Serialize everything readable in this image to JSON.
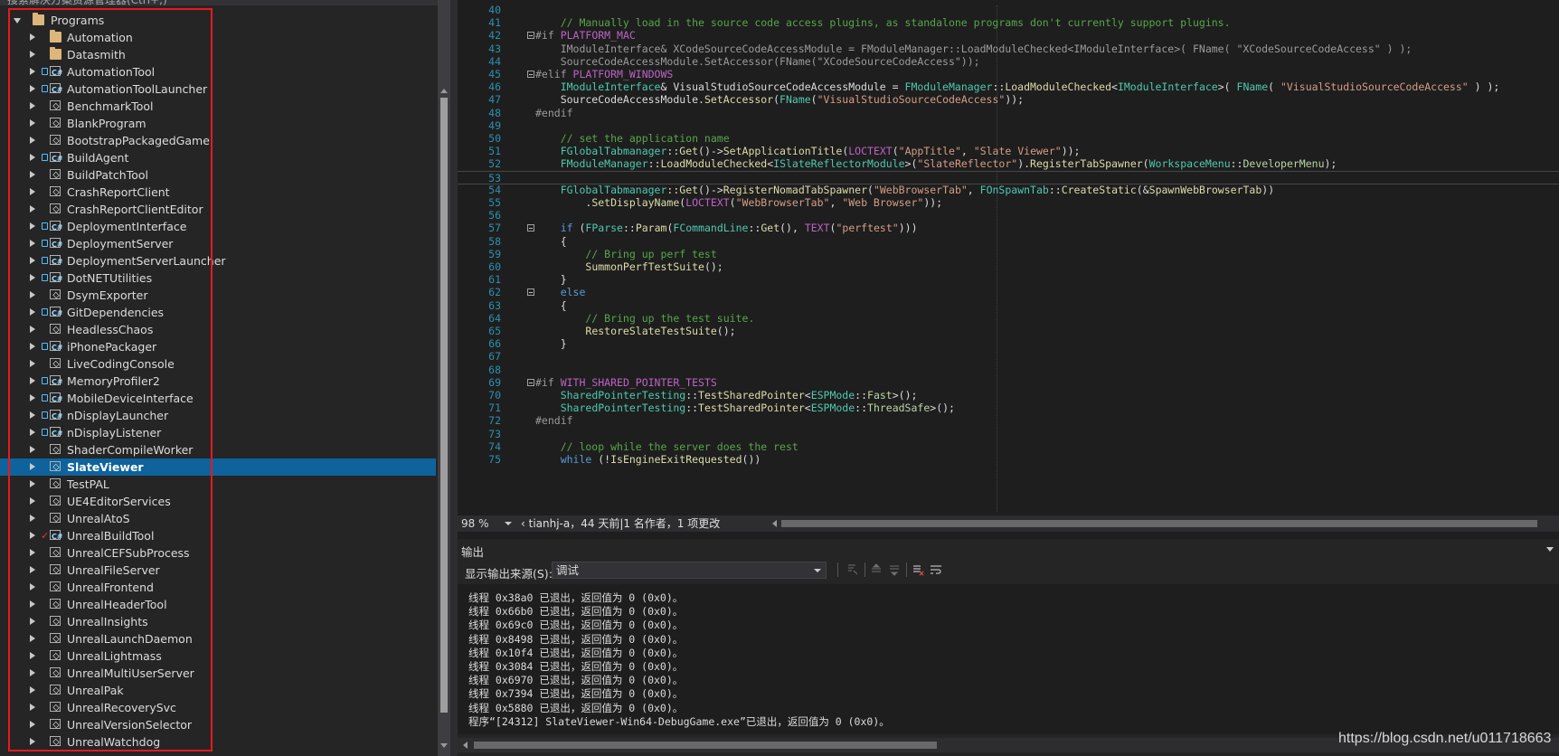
{
  "explorer": {
    "toolbar_text": "搜索解决方案资源管理器(Ctrl+;)",
    "root": {
      "label": "Programs",
      "icon": "folder-icon"
    },
    "items": [
      {
        "label": "Automation",
        "icon": "folder",
        "lock": false,
        "check": false
      },
      {
        "label": "Datasmith",
        "icon": "folder",
        "lock": false,
        "check": false
      },
      {
        "label": "AutomationTool",
        "icon": "cs",
        "lock": true,
        "check": false
      },
      {
        "label": "AutomationToolLauncher",
        "icon": "cs",
        "lock": true,
        "check": false
      },
      {
        "label": "BenchmarkTool",
        "icon": "cpp",
        "lock": false,
        "check": false
      },
      {
        "label": "BlankProgram",
        "icon": "cpp",
        "lock": false,
        "check": false
      },
      {
        "label": "BootstrapPackagedGame",
        "icon": "cpp",
        "lock": false,
        "check": false
      },
      {
        "label": "BuildAgent",
        "icon": "cs",
        "lock": true,
        "check": false
      },
      {
        "label": "BuildPatchTool",
        "icon": "cpp",
        "lock": false,
        "check": false
      },
      {
        "label": "CrashReportClient",
        "icon": "cpp",
        "lock": false,
        "check": false
      },
      {
        "label": "CrashReportClientEditor",
        "icon": "cpp",
        "lock": false,
        "check": false
      },
      {
        "label": "DeploymentInterface",
        "icon": "cs",
        "lock": true,
        "check": false
      },
      {
        "label": "DeploymentServer",
        "icon": "cs",
        "lock": true,
        "check": false
      },
      {
        "label": "DeploymentServerLauncher",
        "icon": "cs",
        "lock": true,
        "check": false
      },
      {
        "label": "DotNETUtilities",
        "icon": "cs",
        "lock": true,
        "check": false
      },
      {
        "label": "DsymExporter",
        "icon": "cpp",
        "lock": false,
        "check": false
      },
      {
        "label": "GitDependencies",
        "icon": "cs",
        "lock": true,
        "check": false
      },
      {
        "label": "HeadlessChaos",
        "icon": "cpp",
        "lock": false,
        "check": false
      },
      {
        "label": "iPhonePackager",
        "icon": "cs",
        "lock": true,
        "check": false
      },
      {
        "label": "LiveCodingConsole",
        "icon": "cpp",
        "lock": false,
        "check": false
      },
      {
        "label": "MemoryProfiler2",
        "icon": "cs",
        "lock": true,
        "check": false
      },
      {
        "label": "MobileDeviceInterface",
        "icon": "cs",
        "lock": true,
        "check": false
      },
      {
        "label": "nDisplayLauncher",
        "icon": "cs",
        "lock": true,
        "check": false
      },
      {
        "label": "nDisplayListener",
        "icon": "cs",
        "lock": true,
        "check": false
      },
      {
        "label": "ShaderCompileWorker",
        "icon": "cpp",
        "lock": false,
        "check": false
      },
      {
        "label": "SlateViewer",
        "icon": "cpp",
        "lock": false,
        "check": false,
        "selected": true
      },
      {
        "label": "TestPAL",
        "icon": "cpp",
        "lock": false,
        "check": false
      },
      {
        "label": "UE4EditorServices",
        "icon": "cpp",
        "lock": false,
        "check": false
      },
      {
        "label": "UnrealAtoS",
        "icon": "cpp",
        "lock": false,
        "check": false
      },
      {
        "label": "UnrealBuildTool",
        "icon": "cs",
        "lock": false,
        "check": true
      },
      {
        "label": "UnrealCEFSubProcess",
        "icon": "cpp",
        "lock": false,
        "check": false
      },
      {
        "label": "UnrealFileServer",
        "icon": "cpp",
        "lock": false,
        "check": false
      },
      {
        "label": "UnrealFrontend",
        "icon": "cpp",
        "lock": false,
        "check": false
      },
      {
        "label": "UnrealHeaderTool",
        "icon": "cpp",
        "lock": false,
        "check": false
      },
      {
        "label": "UnrealInsights",
        "icon": "cpp",
        "lock": false,
        "check": false
      },
      {
        "label": "UnrealLaunchDaemon",
        "icon": "cpp",
        "lock": false,
        "check": false
      },
      {
        "label": "UnrealLightmass",
        "icon": "cpp",
        "lock": false,
        "check": false
      },
      {
        "label": "UnrealMultiUserServer",
        "icon": "cpp",
        "lock": false,
        "check": false
      },
      {
        "label": "UnrealPak",
        "icon": "cpp",
        "lock": false,
        "check": false
      },
      {
        "label": "UnrealRecoverySvc",
        "icon": "cpp",
        "lock": false,
        "check": false
      },
      {
        "label": "UnrealVersionSelector",
        "icon": "cpp",
        "lock": false,
        "check": false
      },
      {
        "label": "UnrealWatchdog",
        "icon": "cpp",
        "lock": false,
        "check": false
      }
    ],
    "annotation_color": "#e8191b",
    "selection_color": "#0e639c"
  },
  "editor": {
    "lines": [
      {
        "n": "40",
        "fold": false,
        "tokens": [
          [
            "",
            "plain"
          ]
        ]
      },
      {
        "n": "41",
        "fold": false,
        "tokens": [
          [
            "    // Manually load in the source code access plugins, as standalone programs don't currently support plugins.",
            "comment"
          ]
        ]
      },
      {
        "n": "42",
        "fold": true,
        "tokens": [
          [
            "#if ",
            "pp"
          ],
          [
            "PLATFORM_MAC",
            "macro"
          ]
        ]
      },
      {
        "n": "43",
        "fold": false,
        "tokens": [
          [
            "    IModuleInterface& XCodeSourceCodeAccessModule = FModuleManager::LoadModuleChecked<IModuleInterface>( FName( \"XCodeSourceCodeAccess\" ) );",
            "pp"
          ]
        ]
      },
      {
        "n": "44",
        "fold": false,
        "tokens": [
          [
            "    SourceCodeAccessModule.SetAccessor(FName(\"XCodeSourceCodeAccess\"));",
            "pp"
          ]
        ]
      },
      {
        "n": "45",
        "fold": true,
        "tokens": [
          [
            "#elif ",
            "pp"
          ],
          [
            "PLATFORM_WINDOWS",
            "macro"
          ]
        ]
      },
      {
        "n": "46",
        "fold": false,
        "tokens": [
          [
            "    ",
            "plain"
          ],
          [
            "IModuleInterface",
            "type"
          ],
          [
            "& VisualStudioSourceCodeAccessModule = ",
            "plain"
          ],
          [
            "FModuleManager",
            "type"
          ],
          [
            "::",
            "plain"
          ],
          [
            "LoadModuleChecked",
            "fn"
          ],
          [
            "<",
            "plain"
          ],
          [
            "IModuleInterface",
            "type"
          ],
          [
            ">( ",
            "plain"
          ],
          [
            "FName",
            "type"
          ],
          [
            "( ",
            "plain"
          ],
          [
            "\"VisualStudioSourceCodeAccess\"",
            "str"
          ],
          [
            " ) );",
            "plain"
          ]
        ]
      },
      {
        "n": "47",
        "fold": false,
        "tokens": [
          [
            "    SourceCodeAccessModule.",
            "plain"
          ],
          [
            "SetAccessor",
            "fn"
          ],
          [
            "(",
            "plain"
          ],
          [
            "FName",
            "type"
          ],
          [
            "(",
            "plain"
          ],
          [
            "\"VisualStudioSourceCodeAccess\"",
            "str"
          ],
          [
            "));",
            "plain"
          ]
        ]
      },
      {
        "n": "48",
        "fold": false,
        "tokens": [
          [
            "#endif",
            "pp"
          ]
        ]
      },
      {
        "n": "49",
        "fold": false,
        "tokens": [
          [
            "",
            "plain"
          ]
        ]
      },
      {
        "n": "50",
        "fold": false,
        "tokens": [
          [
            "    // set the application name",
            "comment"
          ]
        ]
      },
      {
        "n": "51",
        "fold": false,
        "tokens": [
          [
            "    ",
            "plain"
          ],
          [
            "FGlobalTabmanager",
            "type"
          ],
          [
            "::",
            "plain"
          ],
          [
            "Get",
            "fn"
          ],
          [
            "()->",
            "plain"
          ],
          [
            "SetApplicationTitle",
            "fn"
          ],
          [
            "(",
            "plain"
          ],
          [
            "LOCTEXT",
            "macro"
          ],
          [
            "(",
            "plain"
          ],
          [
            "\"AppTitle\"",
            "str"
          ],
          [
            ", ",
            "plain"
          ],
          [
            "\"Slate Viewer\"",
            "str"
          ],
          [
            "));",
            "plain"
          ]
        ]
      },
      {
        "n": "52",
        "fold": false,
        "tokens": [
          [
            "    ",
            "plain"
          ],
          [
            "FModuleManager",
            "type"
          ],
          [
            "::",
            "plain"
          ],
          [
            "LoadModuleChecked",
            "fn"
          ],
          [
            "<",
            "plain"
          ],
          [
            "ISlateReflectorModule",
            "type"
          ],
          [
            ">(",
            "plain"
          ],
          [
            "\"SlateReflector\"",
            "str"
          ],
          [
            ").",
            "plain"
          ],
          [
            "RegisterTabSpawner",
            "fn"
          ],
          [
            "(",
            "plain"
          ],
          [
            "WorkspaceMenu",
            "type"
          ],
          [
            "::",
            "plain"
          ],
          [
            "DeveloperMenu",
            "purple"
          ],
          [
            ");",
            "plain"
          ]
        ]
      },
      {
        "n": "53",
        "fold": false,
        "current": true,
        "tokens": [
          [
            "",
            "plain"
          ]
        ]
      },
      {
        "n": "54",
        "fold": false,
        "tokens": [
          [
            "    ",
            "plain"
          ],
          [
            "FGlobalTabmanager",
            "type"
          ],
          [
            "::",
            "plain"
          ],
          [
            "Get",
            "fn"
          ],
          [
            "()->",
            "plain"
          ],
          [
            "RegisterNomadTabSpawner",
            "fn"
          ],
          [
            "(",
            "plain"
          ],
          [
            "\"WebBrowserTab\"",
            "str"
          ],
          [
            ", ",
            "plain"
          ],
          [
            "FOnSpawnTab",
            "type"
          ],
          [
            "::",
            "plain"
          ],
          [
            "CreateStatic",
            "fn"
          ],
          [
            "(&",
            "plain"
          ],
          [
            "SpawnWebBrowserTab",
            "fn"
          ],
          [
            "))",
            "plain"
          ]
        ]
      },
      {
        "n": "55",
        "fold": false,
        "tokens": [
          [
            "        .",
            "plain"
          ],
          [
            "SetDisplayName",
            "fn"
          ],
          [
            "(",
            "plain"
          ],
          [
            "LOCTEXT",
            "macro"
          ],
          [
            "(",
            "plain"
          ],
          [
            "\"WebBrowserTab\"",
            "str"
          ],
          [
            ", ",
            "plain"
          ],
          [
            "\"Web Browser\"",
            "str"
          ],
          [
            "));",
            "plain"
          ]
        ]
      },
      {
        "n": "56",
        "fold": false,
        "tokens": [
          [
            "",
            "plain"
          ]
        ]
      },
      {
        "n": "57",
        "fold": true,
        "tokens": [
          [
            "    ",
            "plain"
          ],
          [
            "if",
            "kw"
          ],
          [
            " (",
            "plain"
          ],
          [
            "FParse",
            "type"
          ],
          [
            "::",
            "plain"
          ],
          [
            "Param",
            "fn"
          ],
          [
            "(",
            "plain"
          ],
          [
            "FCommandLine",
            "type"
          ],
          [
            "::",
            "plain"
          ],
          [
            "Get",
            "fn"
          ],
          [
            "(), ",
            "plain"
          ],
          [
            "TEXT",
            "macro"
          ],
          [
            "(",
            "plain"
          ],
          [
            "\"perftest\"",
            "str"
          ],
          [
            ")))",
            "plain"
          ]
        ]
      },
      {
        "n": "58",
        "fold": false,
        "tokens": [
          [
            "    {",
            "plain"
          ]
        ]
      },
      {
        "n": "59",
        "fold": false,
        "tokens": [
          [
            "        // Bring up perf test",
            "comment"
          ]
        ]
      },
      {
        "n": "60",
        "fold": false,
        "tokens": [
          [
            "        ",
            "plain"
          ],
          [
            "SummonPerfTestSuite",
            "fn"
          ],
          [
            "();",
            "plain"
          ]
        ]
      },
      {
        "n": "61",
        "fold": false,
        "tokens": [
          [
            "    }",
            "plain"
          ]
        ]
      },
      {
        "n": "62",
        "fold": true,
        "tokens": [
          [
            "    ",
            "plain"
          ],
          [
            "else",
            "kw"
          ]
        ]
      },
      {
        "n": "63",
        "fold": false,
        "tokens": [
          [
            "    {",
            "plain"
          ]
        ]
      },
      {
        "n": "64",
        "fold": false,
        "tokens": [
          [
            "        // Bring up the test suite.",
            "comment"
          ]
        ]
      },
      {
        "n": "65",
        "fold": false,
        "tokens": [
          [
            "        ",
            "plain"
          ],
          [
            "RestoreSlateTestSuite",
            "fn"
          ],
          [
            "();",
            "plain"
          ]
        ]
      },
      {
        "n": "66",
        "fold": false,
        "tokens": [
          [
            "    }",
            "plain"
          ]
        ]
      },
      {
        "n": "67",
        "fold": false,
        "tokens": [
          [
            "",
            "plain"
          ]
        ]
      },
      {
        "n": "68",
        "fold": false,
        "tokens": [
          [
            "",
            "plain"
          ]
        ]
      },
      {
        "n": "69",
        "fold": true,
        "tokens": [
          [
            "#if ",
            "pp"
          ],
          [
            "WITH_SHARED_POINTER_TESTS",
            "macro"
          ]
        ]
      },
      {
        "n": "70",
        "fold": false,
        "tokens": [
          [
            "    ",
            "plain"
          ],
          [
            "SharedPointerTesting",
            "type"
          ],
          [
            "::",
            "plain"
          ],
          [
            "TestSharedPointer",
            "fn"
          ],
          [
            "<",
            "plain"
          ],
          [
            "ESPMode",
            "type"
          ],
          [
            "::",
            "plain"
          ],
          [
            "Fast",
            "purple"
          ],
          [
            ">();",
            "plain"
          ]
        ]
      },
      {
        "n": "71",
        "fold": false,
        "tokens": [
          [
            "    ",
            "plain"
          ],
          [
            "SharedPointerTesting",
            "type"
          ],
          [
            "::",
            "plain"
          ],
          [
            "TestSharedPointer",
            "fn"
          ],
          [
            "<",
            "plain"
          ],
          [
            "ESPMode",
            "type"
          ],
          [
            "::",
            "plain"
          ],
          [
            "ThreadSafe",
            "purple"
          ],
          [
            ">();",
            "plain"
          ]
        ]
      },
      {
        "n": "72",
        "fold": false,
        "tokens": [
          [
            "#endif",
            "pp"
          ]
        ]
      },
      {
        "n": "73",
        "fold": false,
        "tokens": [
          [
            "",
            "plain"
          ]
        ]
      },
      {
        "n": "74",
        "fold": false,
        "tokens": [
          [
            "    // loop while the server does the rest",
            "comment"
          ]
        ]
      },
      {
        "n": "75",
        "fold": false,
        "tokens": [
          [
            "    ",
            "plain"
          ],
          [
            "while",
            "kw"
          ],
          [
            " (!",
            "plain"
          ],
          [
            "IsEngineExitRequested",
            "fn"
          ],
          [
            "())",
            "plain"
          ]
        ]
      }
    ],
    "zoom": "98 %",
    "git_info": "‹ tianhj-a，44 天前|1 名作者，1 项更改"
  },
  "output": {
    "title": "输出",
    "source_label": "显示输出来源(S):",
    "source_value": "调试",
    "lines": [
      "线程 0x38a0 已退出，返回值为 0 (0x0)。",
      "线程 0x66b0 已退出，返回值为 0 (0x0)。",
      "线程 0x69c0 已退出，返回值为 0 (0x0)。",
      "线程 0x8498 已退出，返回值为 0 (0x0)。",
      "线程 0x10f4 已退出，返回值为 0 (0x0)。",
      "线程 0x3084 已退出，返回值为 0 (0x0)。",
      "线程 0x6970 已退出，返回值为 0 (0x0)。",
      "线程 0x7394 已退出，返回值为 0 (0x0)。",
      "线程 0x5880 已退出，返回值为 0 (0x0)。",
      "程序“[24312] SlateViewer-Win64-DebugGame.exe”已退出，返回值为 0 (0x0)。"
    ]
  },
  "watermark": "https://blog.csdn.net/u011718663"
}
